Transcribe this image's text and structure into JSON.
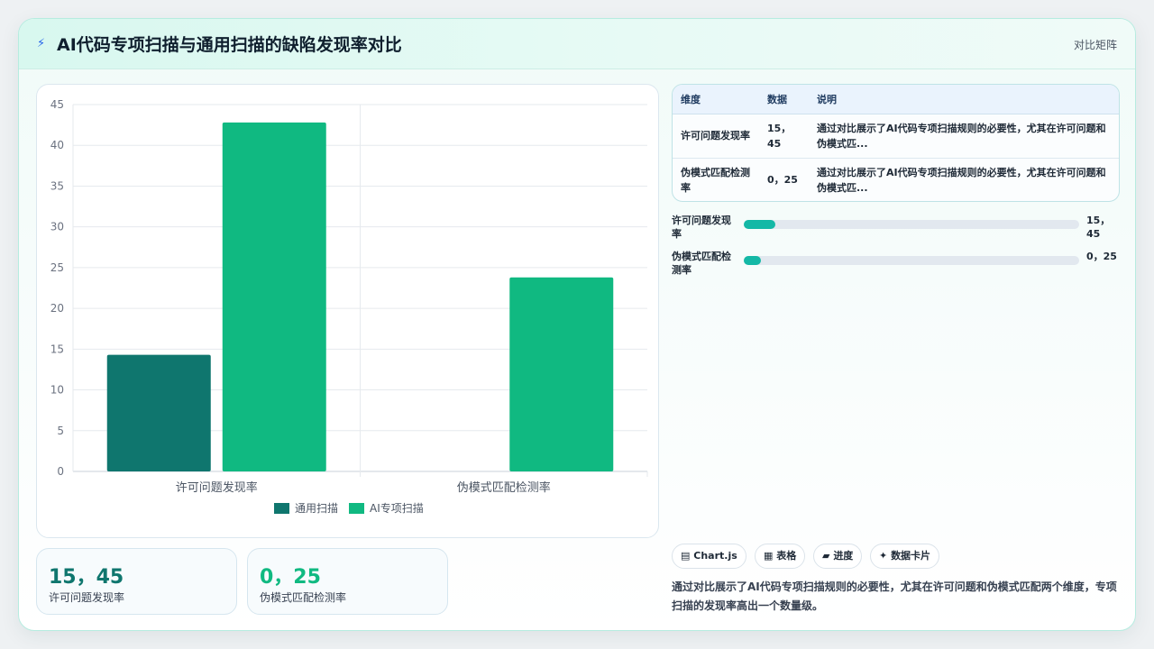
{
  "header": {
    "icon": "bolt-icon",
    "title": "AI代码专项扫描与通用扫描的缺陷发现率对比",
    "tag": "对比矩阵"
  },
  "chart_data": {
    "type": "bar",
    "categories": [
      "许可问题发现率",
      "伪模式匹配检测率"
    ],
    "series": [
      {
        "name": "通用扫描",
        "values": [
          14.3,
          0
        ],
        "color": "#0f766e"
      },
      {
        "name": "AI专项扫描",
        "values": [
          42.8,
          23.8
        ],
        "color": "#10b981"
      }
    ],
    "yticks": [
      0,
      5,
      10,
      15,
      20,
      25,
      30,
      35,
      40,
      45
    ],
    "ylim": [
      0,
      45
    ],
    "grid": true,
    "legend": "bottom"
  },
  "stats": [
    {
      "value": "15，45",
      "label": "许可问题发现率",
      "color": "#0f766e"
    },
    {
      "value": "0，25",
      "label": "伪模式匹配检测率",
      "color": "#10b981"
    }
  ],
  "table": {
    "headers": [
      "维度",
      "数据",
      "说明"
    ],
    "rows": [
      {
        "dim": "许可问题发现率",
        "data": "15，45",
        "desc": "通过对比展示了AI代码专项扫描规则的必要性，尤其在许可问题和伪模式匹..."
      },
      {
        "dim": "伪模式匹配检测率",
        "data": "0，25",
        "desc": "通过对比展示了AI代码专项扫描规则的必要性，尤其在许可问题和伪模式匹..."
      }
    ]
  },
  "progress": [
    {
      "label": "许可问题发现率",
      "value": "15，45",
      "fraction": 0.095
    },
    {
      "label": "伪模式匹配检测率",
      "value": "0，25",
      "fraction": 0.05
    }
  ],
  "chips": [
    {
      "icon": "▤",
      "label": "Chart.js"
    },
    {
      "icon": "▦",
      "label": "表格"
    },
    {
      "icon": "▰",
      "label": "进度"
    },
    {
      "icon": "✦",
      "label": "数据卡片"
    }
  ],
  "summary": "通过对比展示了AI代码专项扫描规则的必要性，尤其在许可问题和伪模式匹配两个维度，专项扫描的发现率高出一个数量级。"
}
